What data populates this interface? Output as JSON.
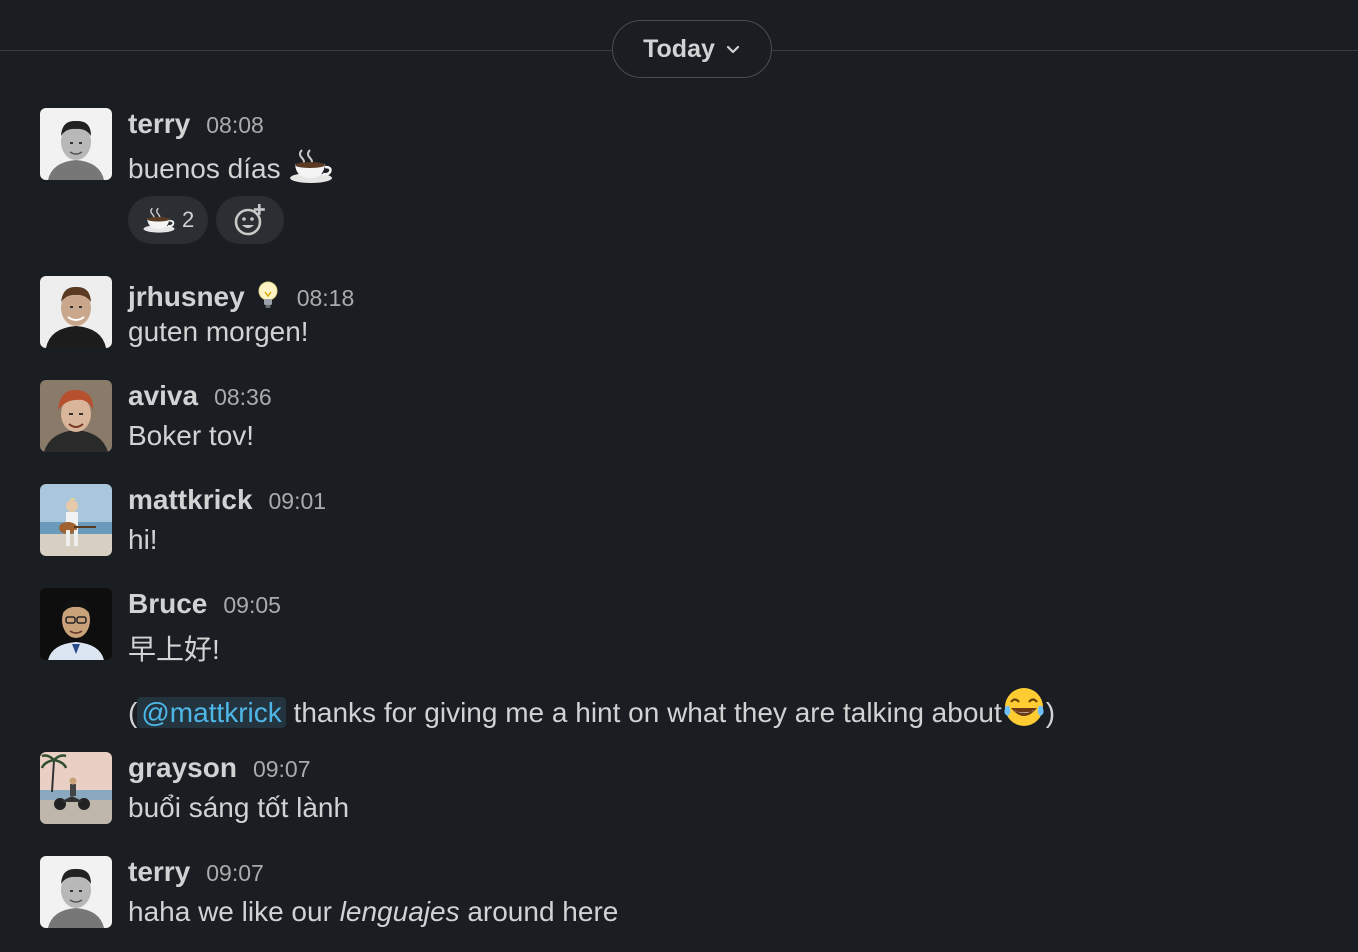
{
  "divider": {
    "label": "Today"
  },
  "messages": [
    {
      "name": "terry",
      "time": "08:08",
      "text": "buenos días",
      "reaction_count": "2"
    },
    {
      "name": "jrhusney",
      "time": "08:18",
      "text": "guten morgen!"
    },
    {
      "name": "aviva",
      "time": "08:36",
      "text": "Boker tov!"
    },
    {
      "name": "mattkrick",
      "time": "09:01",
      "text": "hi!"
    },
    {
      "name": "Bruce",
      "time": "09:05",
      "text": "早上好!",
      "followup": {
        "open": "(",
        "mention": "@mattkrick",
        "text": " thanks for giving me a hint on what they are talking about",
        "close": ")"
      }
    },
    {
      "name": "grayson",
      "time": "09:07",
      "text": "buổi sáng tốt lành"
    },
    {
      "name": "terry",
      "time": "09:07",
      "text_before": "haha we like our ",
      "text_italic": "lenguajes",
      "text_after": " around here"
    }
  ],
  "icons": {
    "date_chevron": "chevron-down-icon",
    "coffee": "hot-beverage-emoji",
    "add_reaction": "add-reaction-icon",
    "status": "light-bulb-emoji",
    "laugh": "tears-of-joy-emoji"
  },
  "colors": {
    "background": "#1a1d21",
    "text": "#d1d2d3",
    "timestamp": "#ababad",
    "mention_text": "#4eb7e8",
    "mention_bg": "#24343e",
    "reaction_bg": "#2b2e32"
  }
}
